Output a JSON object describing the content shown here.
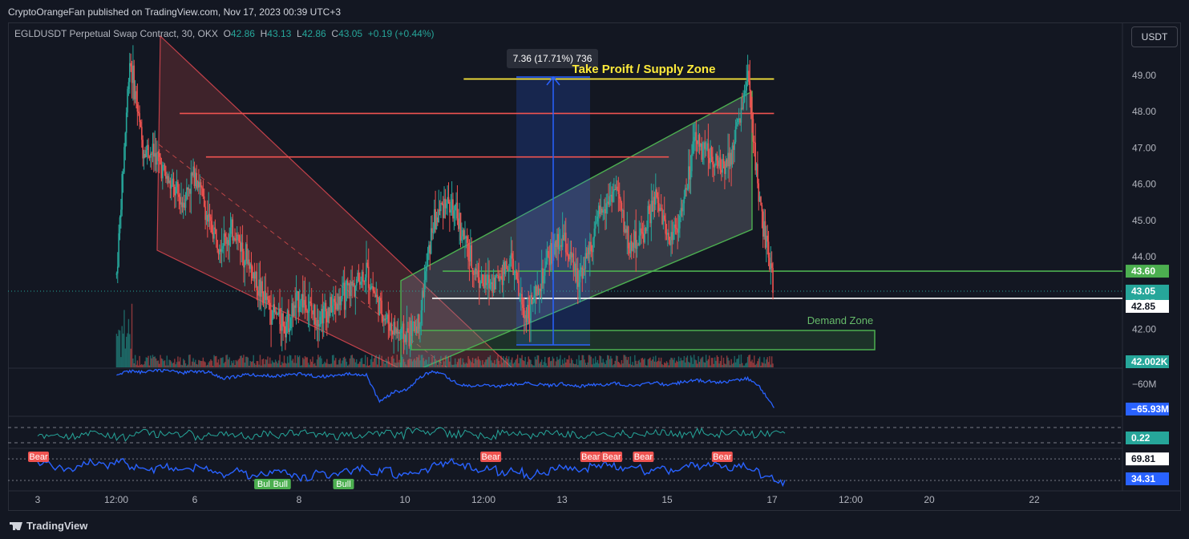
{
  "header": {
    "publish_line": "CryptoOrangeFan published on TradingView.com, Nov 17, 2023 00:39 UTC+3"
  },
  "legend": {
    "symbol": "EGLDUSDT Perpetual Swap Contract, 30, OKX",
    "o_label": "O",
    "o": "42.86",
    "h_label": "H",
    "h": "43.13",
    "l_label": "L",
    "l": "42.86",
    "c_label": "C",
    "c": "43.05",
    "chg": "+0.19 (+0.44%)"
  },
  "currency_button": "USDT",
  "footer": {
    "brand": "TradingView"
  },
  "colors": {
    "bg": "#131722",
    "up": "#26a69a",
    "down": "#ef5350",
    "blue_line": "#2962ff",
    "yellow": "#ffeb3b",
    "green_zone": "#4caf50"
  },
  "chart_data": {
    "type": "line",
    "symbol": "EGLDUSDT Perpetual Swap Contract",
    "timeframe": "30",
    "ylim": [
      41.2,
      50.2
    ],
    "price_ticks": [
      "49.00",
      "48.00",
      "47.00",
      "46.00",
      "45.00",
      "44.00",
      "42.00"
    ],
    "x_ticks": [
      "3",
      "12:00",
      "6",
      "8",
      "10",
      "12:00",
      "13",
      "15",
      "17",
      "12:00",
      "20",
      "22"
    ],
    "price_labels": {
      "level_1": "43.60",
      "last": "43.05",
      "countdown": "20:55",
      "prev": "42.85",
      "volume": "42.002K"
    },
    "x": [
      3.0,
      3.25,
      3.5,
      3.75,
      4.0,
      4.25,
      4.5,
      4.75,
      5.0,
      5.25,
      5.5,
      5.75,
      6.0,
      6.25,
      6.5,
      6.75,
      7.0,
      7.25,
      7.5,
      7.75,
      8.0,
      8.25,
      8.5,
      8.75,
      9.0,
      9.25,
      9.5,
      9.75,
      10.0,
      10.25,
      10.5,
      10.75,
      11.0,
      11.25,
      11.5,
      11.75,
      12.0,
      12.25,
      12.5,
      12.75,
      13.0,
      13.25,
      13.5,
      13.75,
      14.0,
      14.25,
      14.5,
      14.75,
      15.0,
      15.25,
      15.5,
      15.75,
      16.0,
      16.25,
      16.5,
      16.75,
      17.0
    ],
    "price": [
      null,
      null,
      null,
      null,
      null,
      null,
      43.5,
      49.5,
      47.0,
      46.8,
      46.0,
      45.5,
      46.4,
      44.9,
      44.4,
      44.7,
      43.9,
      43.0,
      42.4,
      42.2,
      42.9,
      42.4,
      42.5,
      42.8,
      43.2,
      43.6,
      42.6,
      42.0,
      41.8,
      42.2,
      44.8,
      45.6,
      45.0,
      43.8,
      43.2,
      43.4,
      43.9,
      42.4,
      42.9,
      44.1,
      44.5,
      43.4,
      44.2,
      45.4,
      45.9,
      44.3,
      44.6,
      45.6,
      44.5,
      45.2,
      47.2,
      46.9,
      46.4,
      47.2,
      48.9,
      45.2,
      43.05
    ],
    "price_markers": [
      "Take Proift / Supply Zone",
      "Demand Zone"
    ],
    "measure_label": "7.36 (17.71%) 736",
    "levels": {
      "supply": 48.9,
      "resistance_1": 47.95,
      "resistance_2": 46.75,
      "support": 43.6,
      "current": 42.85
    },
    "zones": {
      "demand": [
        41.65,
        42.0
      ]
    },
    "indicators": [
      {
        "name": "volume_flow",
        "value_label": "−65.93M",
        "tick": "−60M",
        "values": [
          null,
          null,
          null,
          null,
          null,
          null,
          -57.5,
          -56.8,
          -57.0,
          -56.5,
          -56.6,
          -57.2,
          -56.8,
          -57.0,
          -58.5,
          -58.2,
          -57.6,
          -57.8,
          -58.0,
          -57.6,
          -57.5,
          -57.9,
          -58.1,
          -57.7,
          -57.4,
          -57.6,
          -64.5,
          -62.0,
          -61.5,
          -58.5,
          -56.6,
          -58.0,
          -60.0,
          -60.5,
          -60.3,
          -60.6,
          -60.2,
          -59.8,
          -60.0,
          -60.4,
          -59.9,
          -60.5,
          -60.2,
          -60.1,
          -59.8,
          -60.3,
          -60.0,
          -59.7,
          -60.2,
          -59.5,
          -59.0,
          -59.3,
          -59.6,
          -59.0,
          -58.5,
          -61.0,
          -65.9
        ]
      },
      {
        "name": "oscillator",
        "value_label": "0.22",
        "values": [
          0.0,
          0.1,
          -0.05,
          0.05,
          0.15,
          0.0,
          -0.1,
          0.1,
          0.2,
          0.05,
          0.0,
          0.1,
          -0.1,
          0.05,
          0.15,
          0.0,
          -0.05,
          0.1,
          0.0,
          0.1,
          0.15,
          0.05,
          -0.05,
          0.1,
          0.0,
          0.05,
          0.1,
          0.0,
          0.2,
          0.1,
          0.25,
          0.05,
          0.1,
          0.0,
          -0.05,
          0.1,
          0.05,
          0.0,
          0.1,
          0.15,
          0.05,
          0.0,
          0.1,
          0.05,
          0.1,
          0.0,
          0.05,
          0.15,
          0.1,
          0.0,
          0.2,
          0.05,
          0.1,
          0.15,
          0.05,
          0.1,
          0.22
        ]
      },
      {
        "name": "rsi",
        "upper_label": "69.81",
        "value_label": "34.31",
        "values": [
          62,
          58,
          55,
          62,
          65,
          60,
          66,
          58,
          54,
          60,
          55,
          52,
          58,
          50,
          46,
          52,
          44,
          48,
          54,
          46,
          42,
          50,
          45,
          52,
          56,
          50,
          54,
          46,
          48,
          52,
          62,
          66,
          60,
          52,
          55,
          48,
          52,
          44,
          50,
          58,
          56,
          52,
          60,
          62,
          54,
          58,
          50,
          56,
          52,
          60,
          58,
          62,
          56,
          60,
          54,
          46,
          34.31
        ],
        "signals": [
          {
            "label": "Bear",
            "x": 3.0
          },
          {
            "label": "Bull",
            "x": 7.3
          },
          {
            "label": "Bull",
            "x": 7.6
          },
          {
            "label": "Bull",
            "x": 8.8
          },
          {
            "label": "Bear",
            "x": 11.6
          },
          {
            "label": "Bear",
            "x": 13.5
          },
          {
            "label": "Bear",
            "x": 13.9
          },
          {
            "label": "Bear",
            "x": 14.5
          },
          {
            "label": "Bear",
            "x": 16.0
          }
        ]
      }
    ]
  }
}
